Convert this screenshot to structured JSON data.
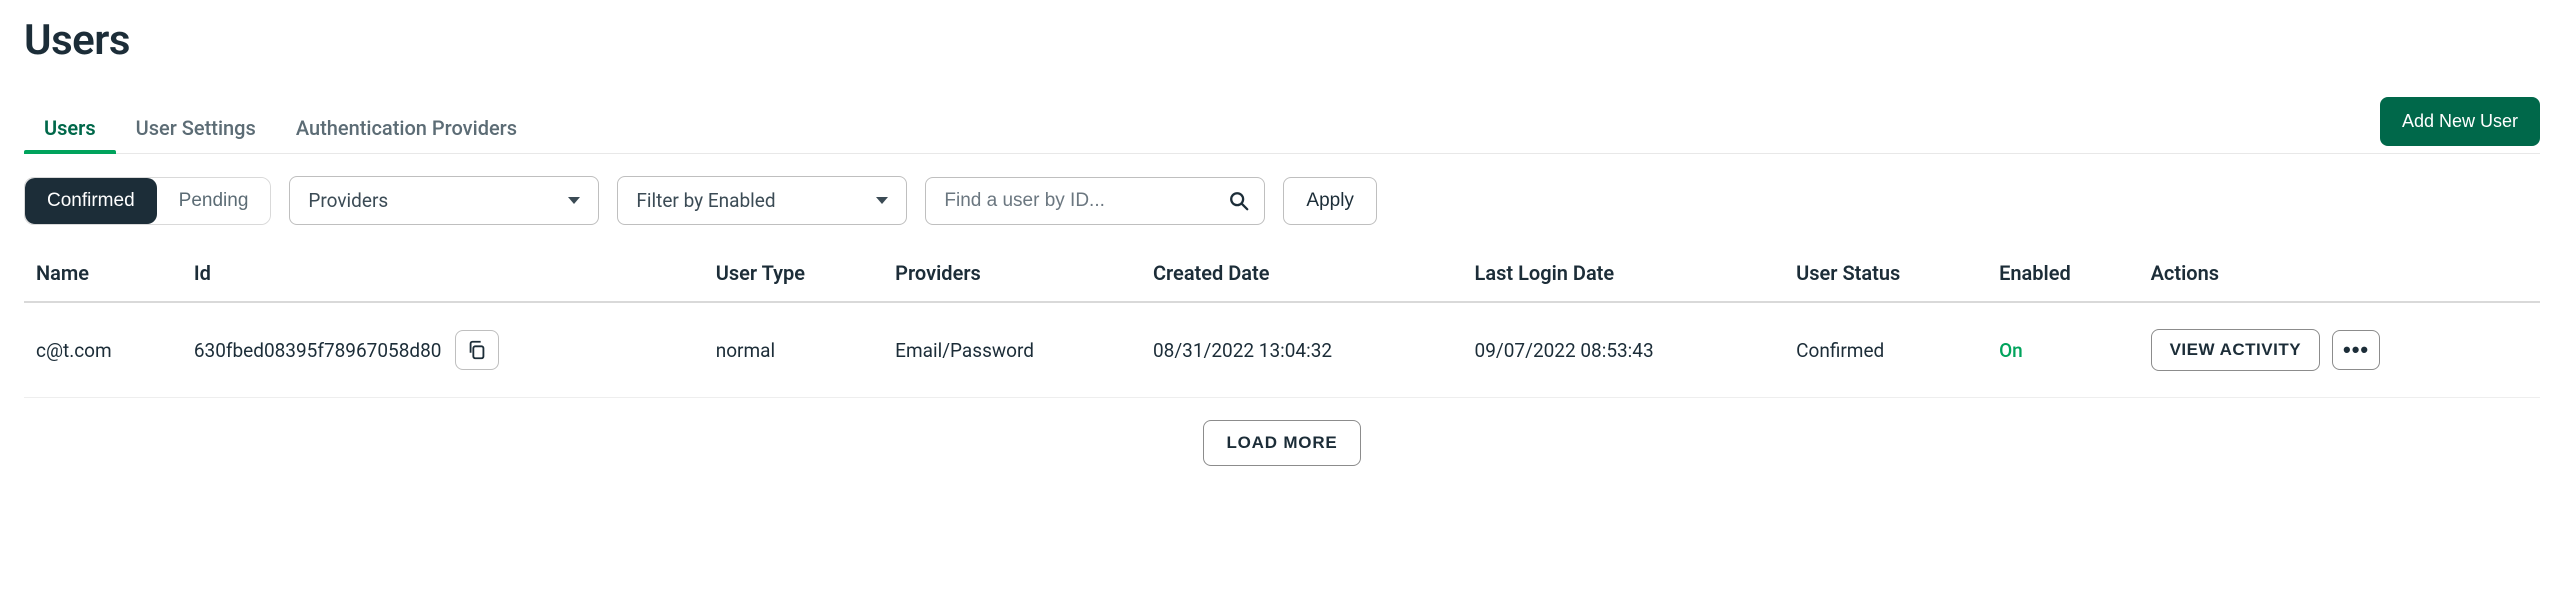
{
  "page": {
    "title": "Users",
    "add_user_label": "Add New User"
  },
  "tabs": [
    {
      "label": "Users",
      "active": true
    },
    {
      "label": "User Settings",
      "active": false
    },
    {
      "label": "Authentication Providers",
      "active": false
    }
  ],
  "filters": {
    "status_toggle": {
      "confirmed": "Confirmed",
      "pending": "Pending",
      "active": "confirmed"
    },
    "providers_select": "Providers",
    "enabled_select": "Filter by Enabled",
    "search_placeholder": "Find a user by ID...",
    "apply_label": "Apply"
  },
  "table": {
    "headers": {
      "name": "Name",
      "id": "Id",
      "user_type": "User Type",
      "providers": "Providers",
      "created_date": "Created Date",
      "last_login_date": "Last Login Date",
      "user_status": "User Status",
      "enabled": "Enabled",
      "actions": "Actions"
    },
    "rows": [
      {
        "name": "c@t.com",
        "id": "630fbed08395f78967058d80",
        "user_type": "normal",
        "providers": "Email/Password",
        "created_date": "08/31/2022 13:04:32",
        "last_login_date": "09/07/2022 08:53:43",
        "user_status": "Confirmed",
        "enabled": "On"
      }
    ],
    "row_actions": {
      "view_activity": "VIEW ACTIVITY",
      "more": "•••"
    },
    "load_more": "LOAD MORE"
  }
}
